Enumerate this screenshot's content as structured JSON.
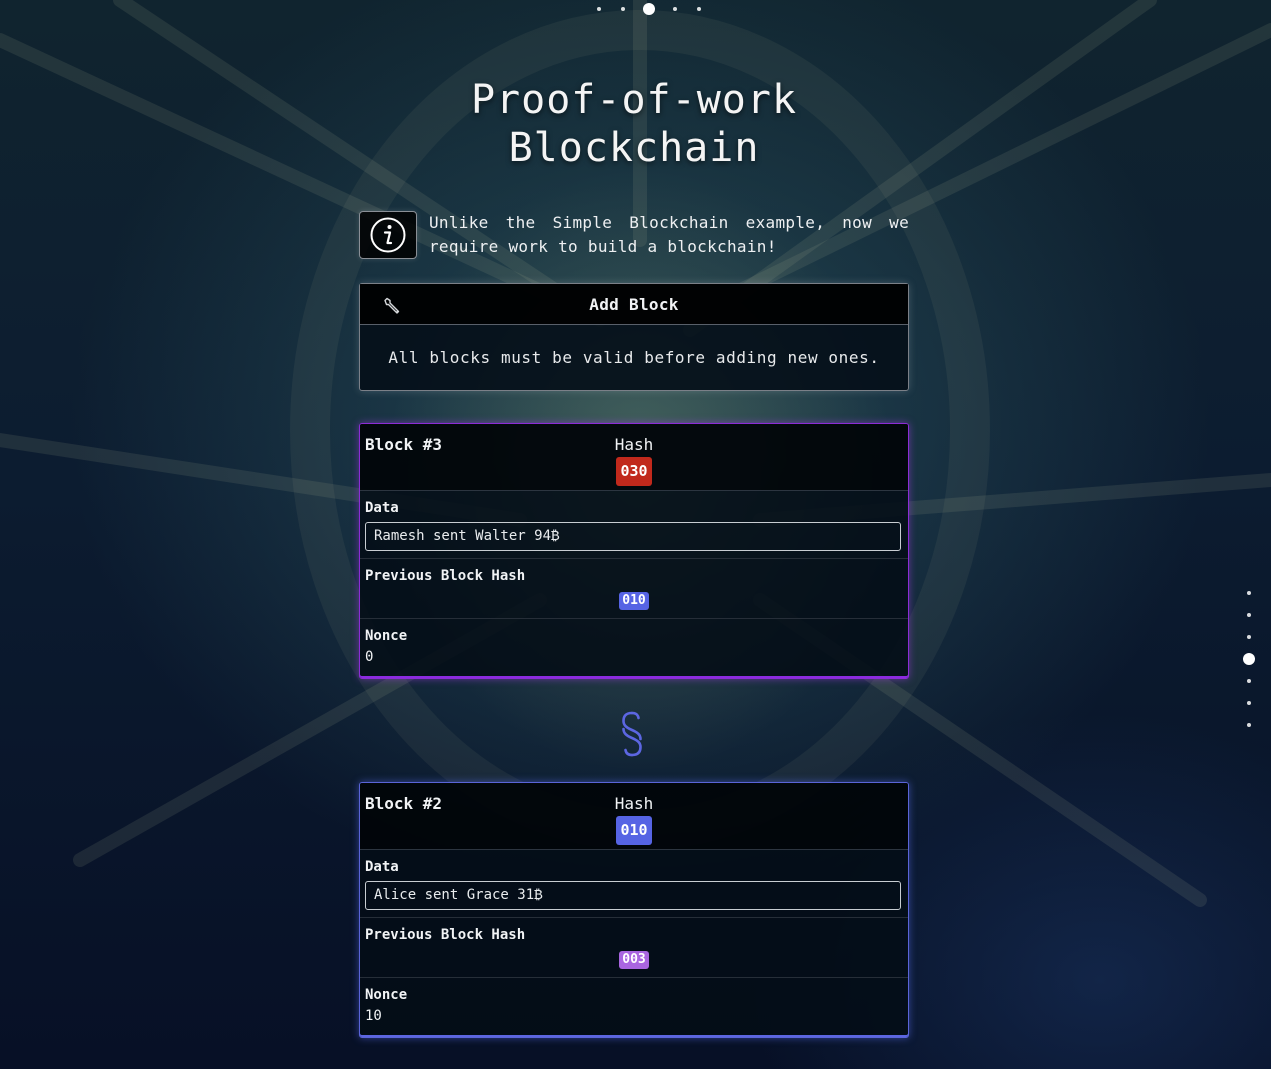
{
  "page": {
    "title_line1": "Proof-of-work",
    "title_line2": "Blockchain"
  },
  "slides": {
    "top_dots": 5,
    "top_active": 3,
    "side_dots": 7,
    "side_active": 4
  },
  "info": {
    "icon": "info-icon",
    "text": "Unlike the Simple Blockchain example, now we require work to build a blockchain!"
  },
  "add_block": {
    "icon": "wrench-icon",
    "title": "Add Block",
    "message": "All blocks must be valid before adding new ones."
  },
  "blocks": [
    {
      "name": "Block #3",
      "hash_label": "Hash",
      "hash": "030",
      "hash_color": "#c1291c",
      "data_label": "Data",
      "data": "Ramesh sent Walter 94₿",
      "prev_label": "Previous Block Hash",
      "prev_hash": "010",
      "prev_hash_color": "#5664e4",
      "nonce_label": "Nonce",
      "nonce": "0",
      "border_color": "#8c2cd6"
    },
    {
      "name": "Block #2",
      "hash_label": "Hash",
      "hash": "010",
      "hash_color": "#5664e4",
      "data_label": "Data",
      "data": "Alice sent Grace 31₿",
      "prev_label": "Previous Block Hash",
      "prev_hash": "003",
      "prev_hash_color": "#a965e0",
      "nonce_label": "Nonce",
      "nonce": "10",
      "border_color": "#5a64d8"
    }
  ],
  "connector": {
    "icon": "chain-link-icon",
    "color": "#5c66e2"
  }
}
